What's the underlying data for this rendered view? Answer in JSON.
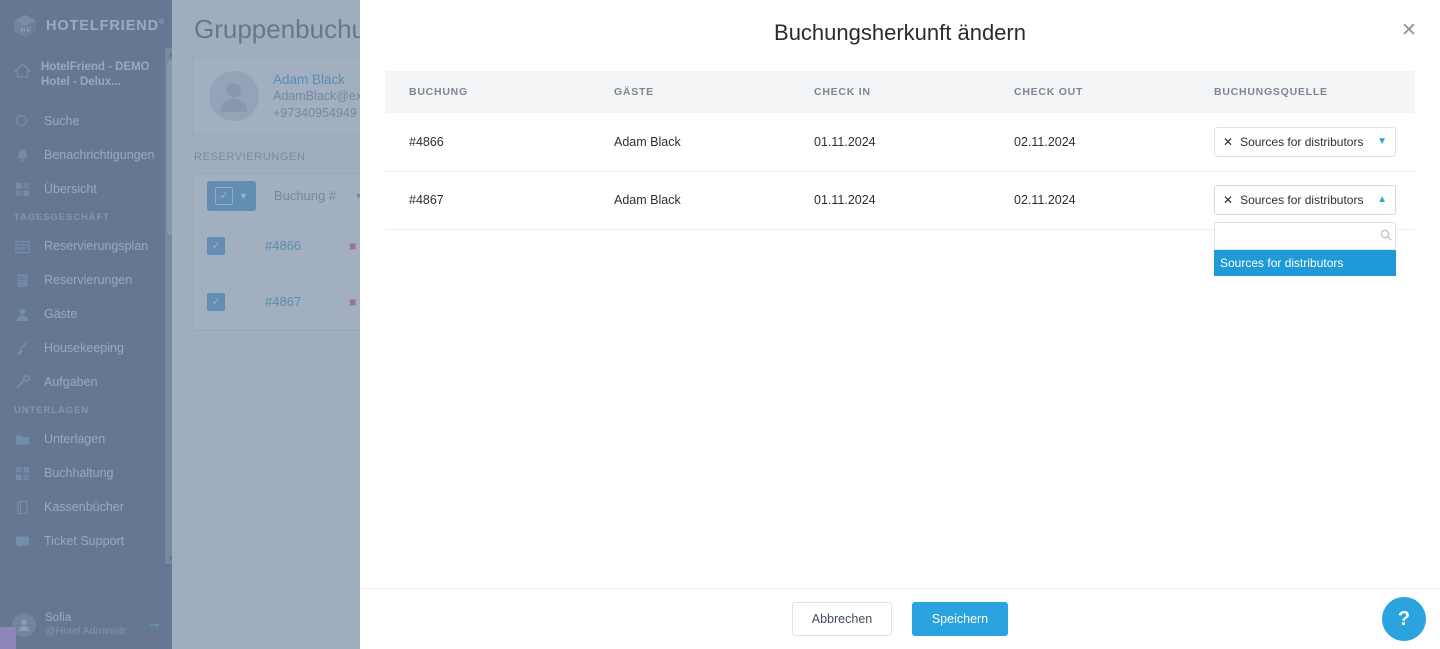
{
  "sidebar": {
    "brand": "HOTELFRIEND",
    "brand_reg": "®",
    "collapse_icon": "chevron-left-icon",
    "hotel": "HotelFriend - DEMO Hotel - Delux...",
    "items_top": [
      {
        "label": "Suche",
        "icon": "search-icon"
      },
      {
        "label": "Benachrichtigungen",
        "icon": "bell-icon"
      },
      {
        "label": "Übersicht",
        "icon": "dashboard-icon"
      }
    ],
    "section_tagesgeschaeft": "TAGESGESCHÄFT",
    "items_tagesgeschaeft": [
      {
        "label": "Reservierungsplan",
        "icon": "calendar-icon"
      },
      {
        "label": "Reservierungen",
        "icon": "document-icon"
      },
      {
        "label": "Gäste",
        "icon": "user-icon"
      },
      {
        "label": "Housekeeping",
        "icon": "broom-icon"
      },
      {
        "label": "Aufgaben",
        "icon": "tools-icon"
      }
    ],
    "section_unterlagen": "UNTERLAGEN",
    "items_unterlagen": [
      {
        "label": "Unterlagen",
        "icon": "folder-icon"
      },
      {
        "label": "Buchhaltung",
        "icon": "grid-icon"
      },
      {
        "label": "Kassenbücher",
        "icon": "book-icon"
      },
      {
        "label": "Ticket Support",
        "icon": "chat-icon"
      }
    ],
    "user": {
      "name": "Sofia",
      "handle": "@Hotel Administr",
      "logout_icon": "logout-arrow-icon"
    }
  },
  "background": {
    "page_title": "Gruppenbuchung",
    "guest": {
      "name": "Adam Black",
      "email": "AdamBlack@ex",
      "phone": "+97340954949"
    },
    "section_label": "RESERVIERUNGEN",
    "table_header_label": "Buchung #",
    "rows": [
      {
        "booking": "#4866"
      },
      {
        "booking": "#4867"
      }
    ]
  },
  "modal": {
    "title": "Buchungsherkunft ändern",
    "close_icon": "close-icon",
    "columns": [
      "BUCHUNG",
      "GÄSTE",
      "CHECK IN",
      "CHECK OUT",
      "BUCHUNGSQUELLE"
    ],
    "rows": [
      {
        "booking": "#4866",
        "guest": "Adam Black",
        "check_in": "01.11.2024",
        "check_out": "02.11.2024",
        "source": "Sources for distributors",
        "open": false
      },
      {
        "booking": "#4867",
        "guest": "Adam Black",
        "check_in": "01.11.2024",
        "check_out": "02.11.2024",
        "source": "Sources for distributors",
        "open": true
      }
    ],
    "dropdown": {
      "search_value": "",
      "search_placeholder": "",
      "search_icon": "search-icon",
      "options": [
        "Sources for distributors"
      ],
      "highlighted": "Sources for distributors"
    },
    "footer": {
      "cancel_label": "Abbrechen",
      "save_label": "Speichern"
    }
  },
  "help": {
    "label": "?"
  },
  "colors": {
    "accent": "#2aa3df",
    "sidebar_bg": "#5f6d80",
    "overlay": "#6b809b",
    "table_header_bg": "#f3f5f7"
  }
}
